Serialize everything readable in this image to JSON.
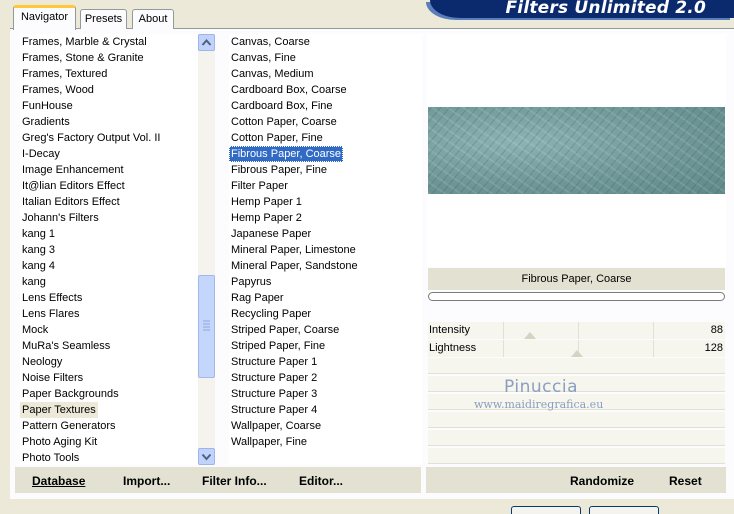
{
  "app_title": "Filters Unlimited 2.0",
  "tabs": [
    "Navigator",
    "Presets",
    "About"
  ],
  "categories": {
    "items": [
      "Frames, Marble & Crystal",
      "Frames, Stone & Granite",
      "Frames, Textured",
      "Frames, Wood",
      "FunHouse",
      "Gradients",
      "Greg's Factory Output Vol. II",
      "I-Decay",
      "Image Enhancement",
      "It@lian Editors Effect",
      "Italian Editors Effect",
      "Johann's Filters",
      "kang 1",
      "kang 3",
      "kang 4",
      "kang",
      "Lens Effects",
      "Lens Flares",
      "Mock",
      "MuRa's Seamless",
      "Neology",
      "Noise Filters",
      "Paper Backgrounds",
      "Paper Textures",
      "Pattern Generators",
      "Photo Aging Kit",
      "Photo Tools"
    ],
    "selected": "Paper Textures"
  },
  "filters": {
    "items": [
      "Canvas, Coarse",
      "Canvas, Fine",
      "Canvas, Medium",
      "Cardboard Box, Coarse",
      "Cardboard Box, Fine",
      "Cotton Paper, Coarse",
      "Cotton Paper, Fine",
      "Fibrous Paper, Coarse",
      "Fibrous Paper, Fine",
      "Filter Paper",
      "Hemp Paper 1",
      "Hemp Paper 2",
      "Japanese Paper",
      "Mineral Paper, Limestone",
      "Mineral Paper, Sandstone",
      "Papyrus",
      "Rag Paper",
      "Recycling Paper",
      "Striped Paper, Coarse",
      "Striped Paper, Fine",
      "Structure Paper 1",
      "Structure Paper 2",
      "Structure Paper 3",
      "Structure Paper 4",
      "Wallpaper, Coarse",
      "Wallpaper, Fine"
    ],
    "selected": "Fibrous Paper, Coarse"
  },
  "preview": {
    "filter_name": "Fibrous Paper, Coarse",
    "texture_color": "#7aa3a4"
  },
  "sliders": [
    {
      "label": "Intensity",
      "value": "88",
      "level": 88
    },
    {
      "label": "Lightness",
      "value": "128",
      "level": 128
    }
  ],
  "watermark": {
    "name": "Pinuccia",
    "url": "www.maidiregrafica.eu"
  },
  "buttons": {
    "database": "Database",
    "import": "Import...",
    "filter_info": "Filter Info...",
    "editor": "Editor...",
    "randomize": "Randomize",
    "reset": "Reset"
  },
  "icons": {
    "scroll_up": "triangle-up",
    "scroll_down": "triangle-down"
  },
  "colors": {
    "banner": "#0b2a6e",
    "selection": "#316ac5",
    "tab_highlight": "#ffc83c"
  }
}
